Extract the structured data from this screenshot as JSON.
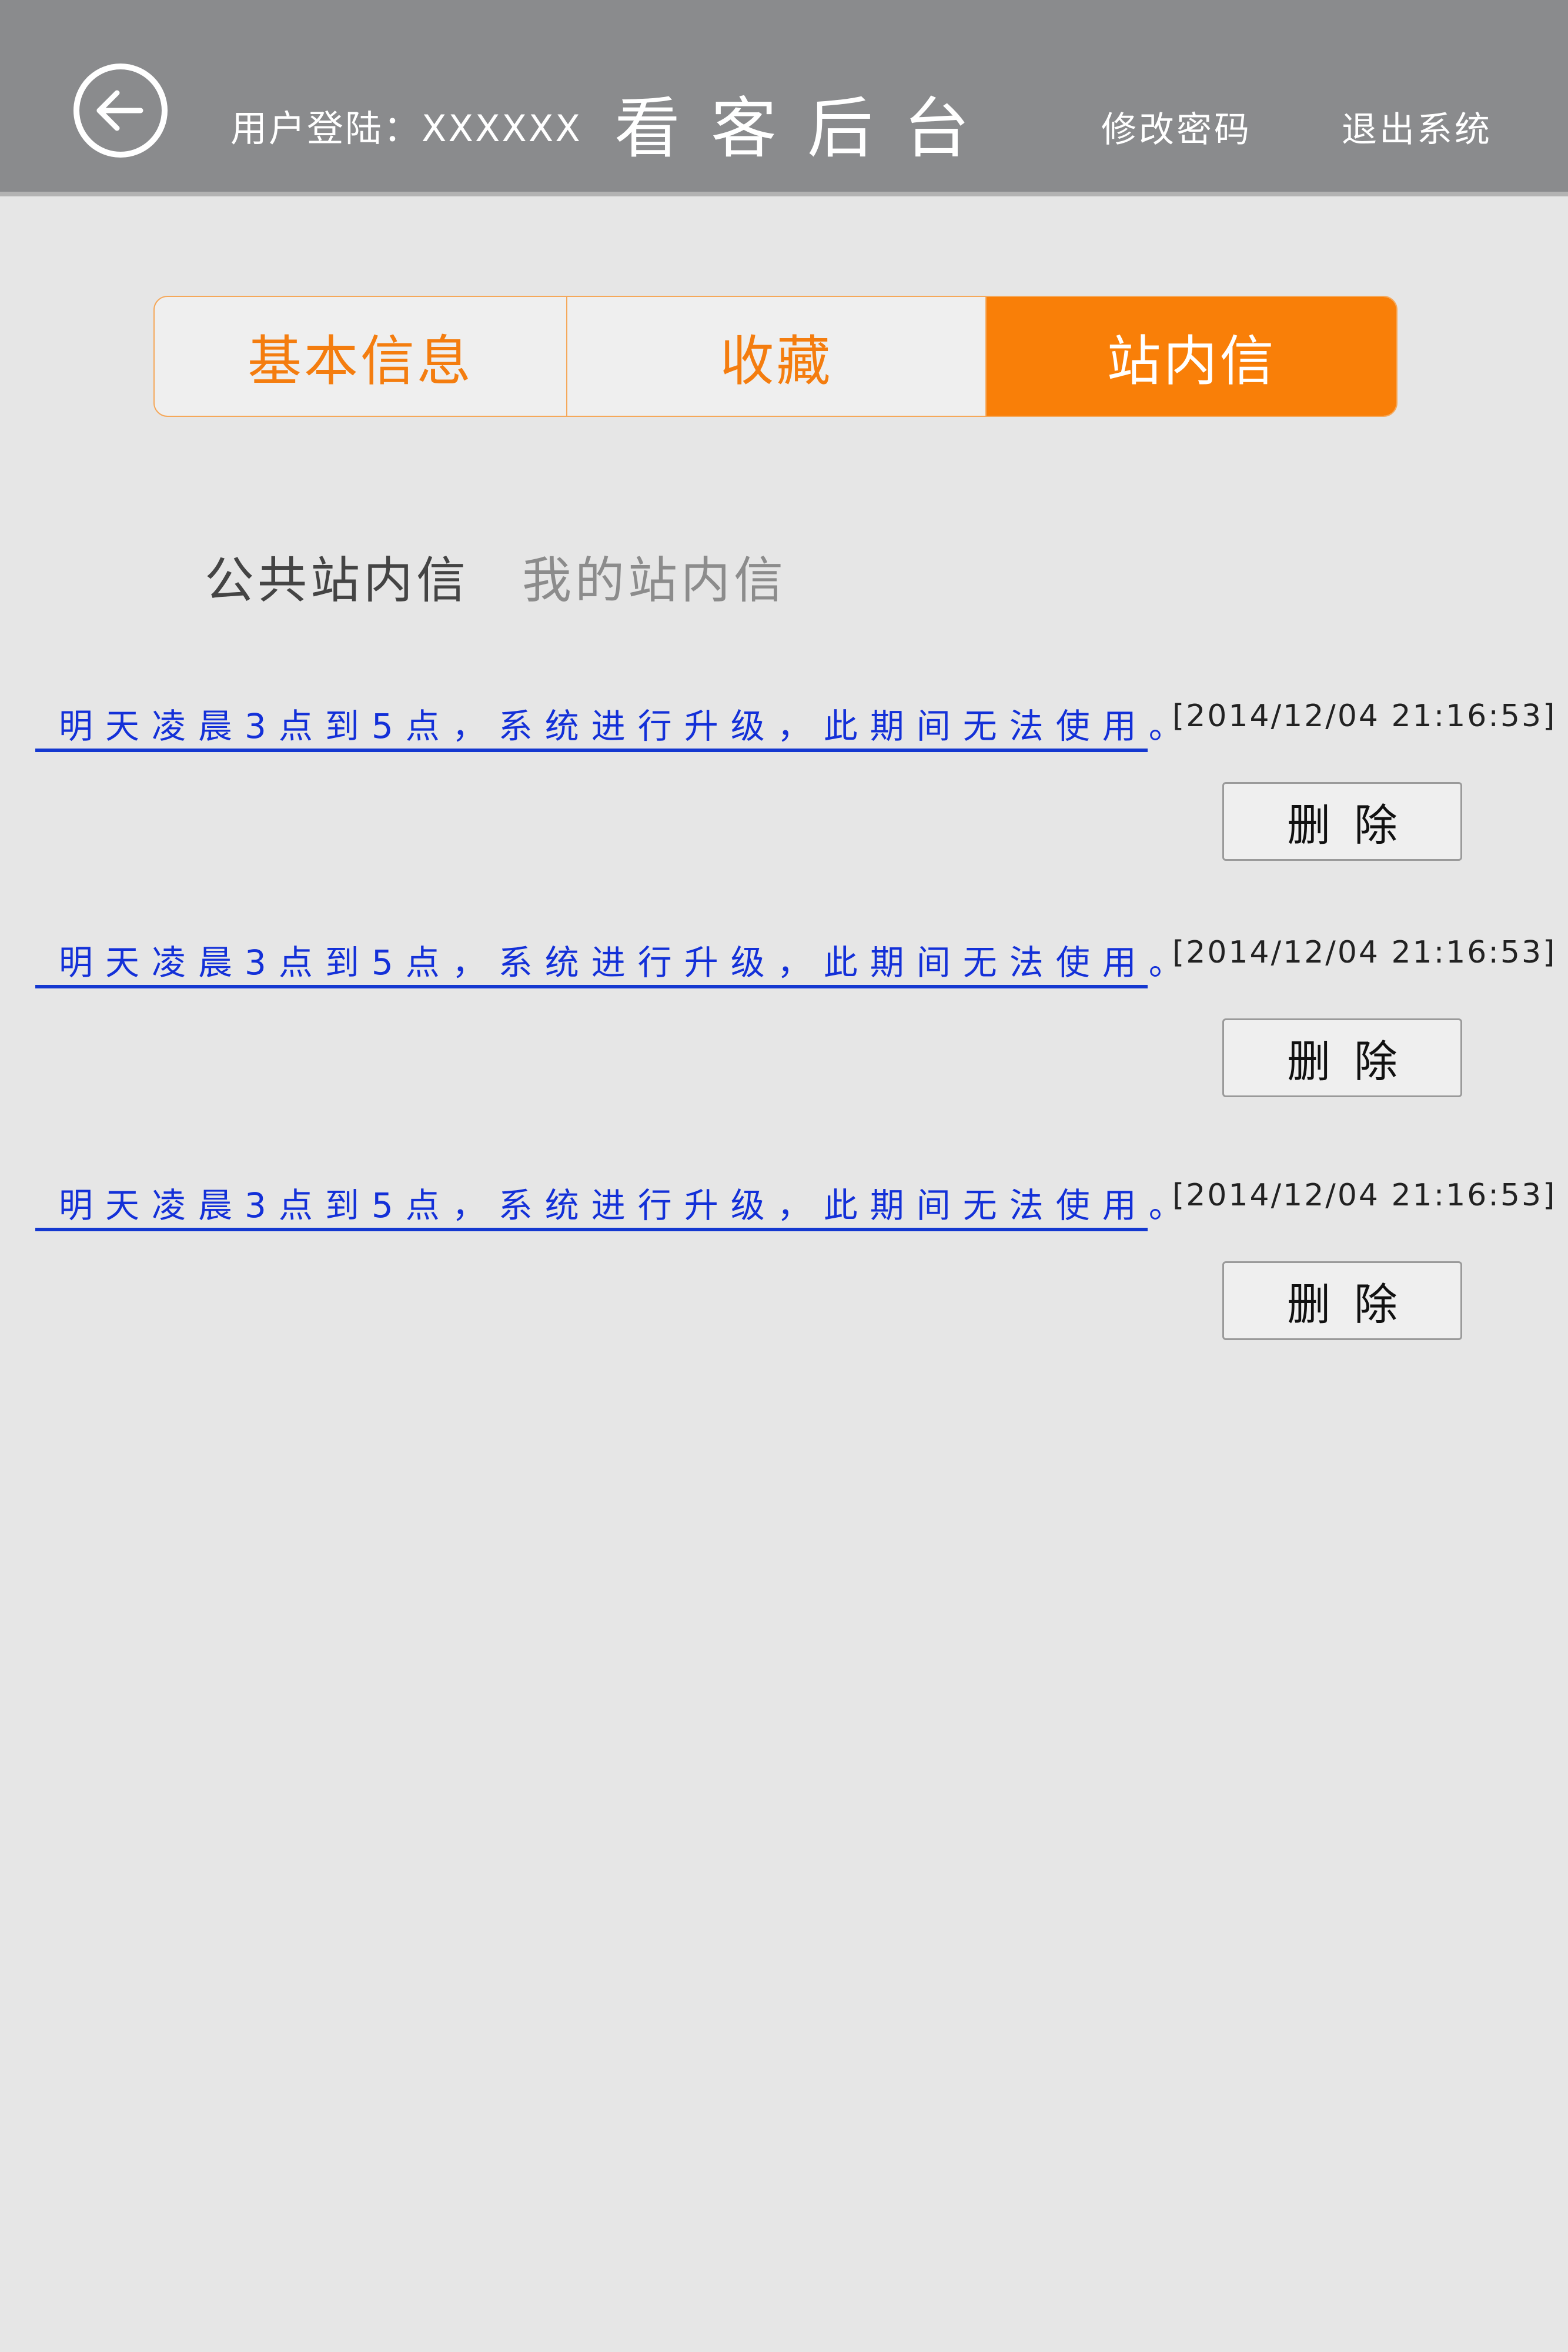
{
  "header": {
    "user_login": "用户登陆：XXXXXX",
    "title": "看客后台",
    "change_password": "修改密码",
    "logout": "退出系统",
    "back_icon": "arrow-left-circle-icon"
  },
  "colors": {
    "header_bg": "#8a8b8d",
    "accent": "#f97f08",
    "link_blue": "#1330d8",
    "page_bg": "#e6e6e6"
  },
  "main_tabs": [
    {
      "label": "基本信息",
      "active": false
    },
    {
      "label": "收藏",
      "active": false
    },
    {
      "label": "站内信",
      "active": true
    }
  ],
  "sub_tabs": [
    {
      "label": "公共站内信",
      "active": true
    },
    {
      "label": "我的站内信",
      "active": false
    }
  ],
  "messages": [
    {
      "text": "明天凌晨3点到5点，系统进行升级，此期间无法使用。",
      "time": "[2014/12/04 21:16:53]",
      "delete_label": "删除"
    },
    {
      "text": "明天凌晨3点到5点，系统进行升级，此期间无法使用。",
      "time": "[2014/12/04 21:16:53]",
      "delete_label": "删除"
    },
    {
      "text": "明天凌晨3点到5点，系统进行升级，此期间无法使用。",
      "time": "[2014/12/04 21:16:53]",
      "delete_label": "删除"
    }
  ]
}
